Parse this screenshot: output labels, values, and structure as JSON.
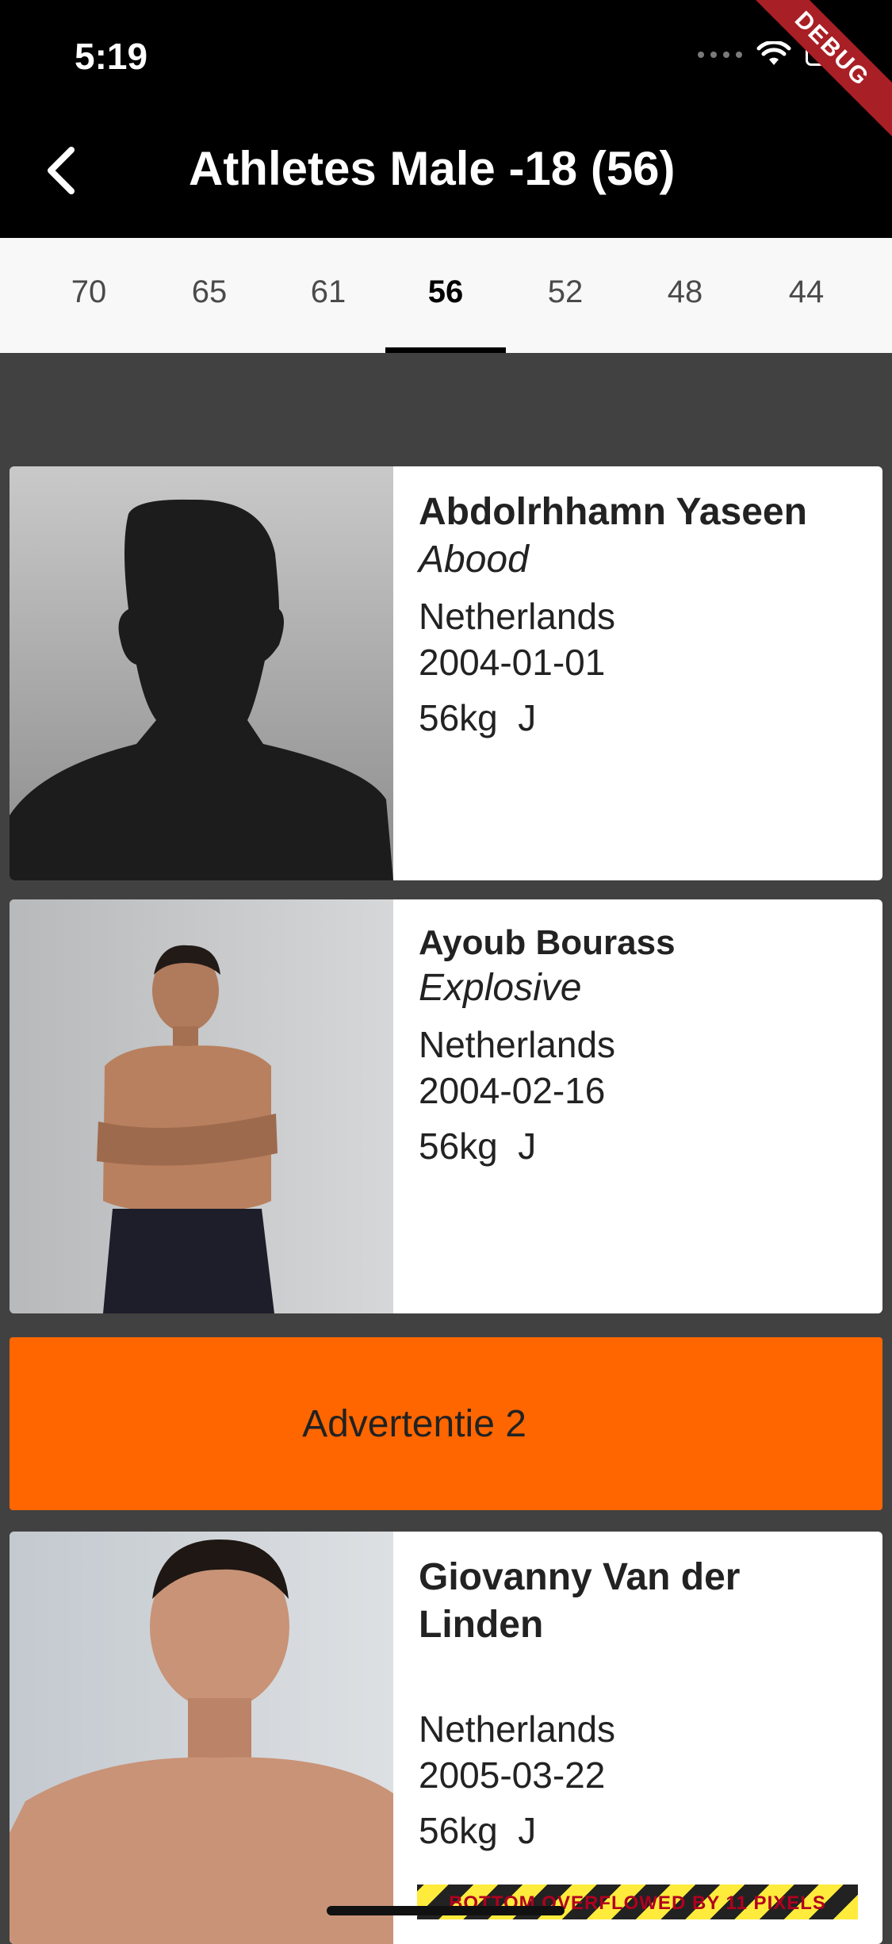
{
  "status_bar": {
    "time": "5:19"
  },
  "debug_banner": "DEBUG",
  "app_bar": {
    "title": "Athletes Male -18 (56)",
    "back_icon": "chevron-left-icon"
  },
  "tabs": [
    {
      "label": "70"
    },
    {
      "label": "65"
    },
    {
      "label": "61"
    },
    {
      "label": "56",
      "active": true
    },
    {
      "label": "52"
    },
    {
      "label": "48"
    },
    {
      "label": "44"
    }
  ],
  "athletes": [
    {
      "name": "Abdolrhhamn Yaseen",
      "nickname": "Abood",
      "country": "Netherlands",
      "dob": "2004-01-01",
      "weight": "56kg  J"
    },
    {
      "name": "Ayoub Bourass",
      "nickname": "Explosive",
      "country": "Netherlands",
      "dob": "2004-02-16",
      "weight": "56kg  J"
    },
    {
      "name": "Giovanny Van der Linden",
      "nickname": "",
      "country": "Netherlands",
      "dob": "2005-03-22",
      "weight": "56kg  J"
    }
  ],
  "ad": {
    "label": "Advertentie 2",
    "color": "#ff6600"
  },
  "overflow_warning": "BOTTOM OVERFLOWED BY 11 PIXELS"
}
